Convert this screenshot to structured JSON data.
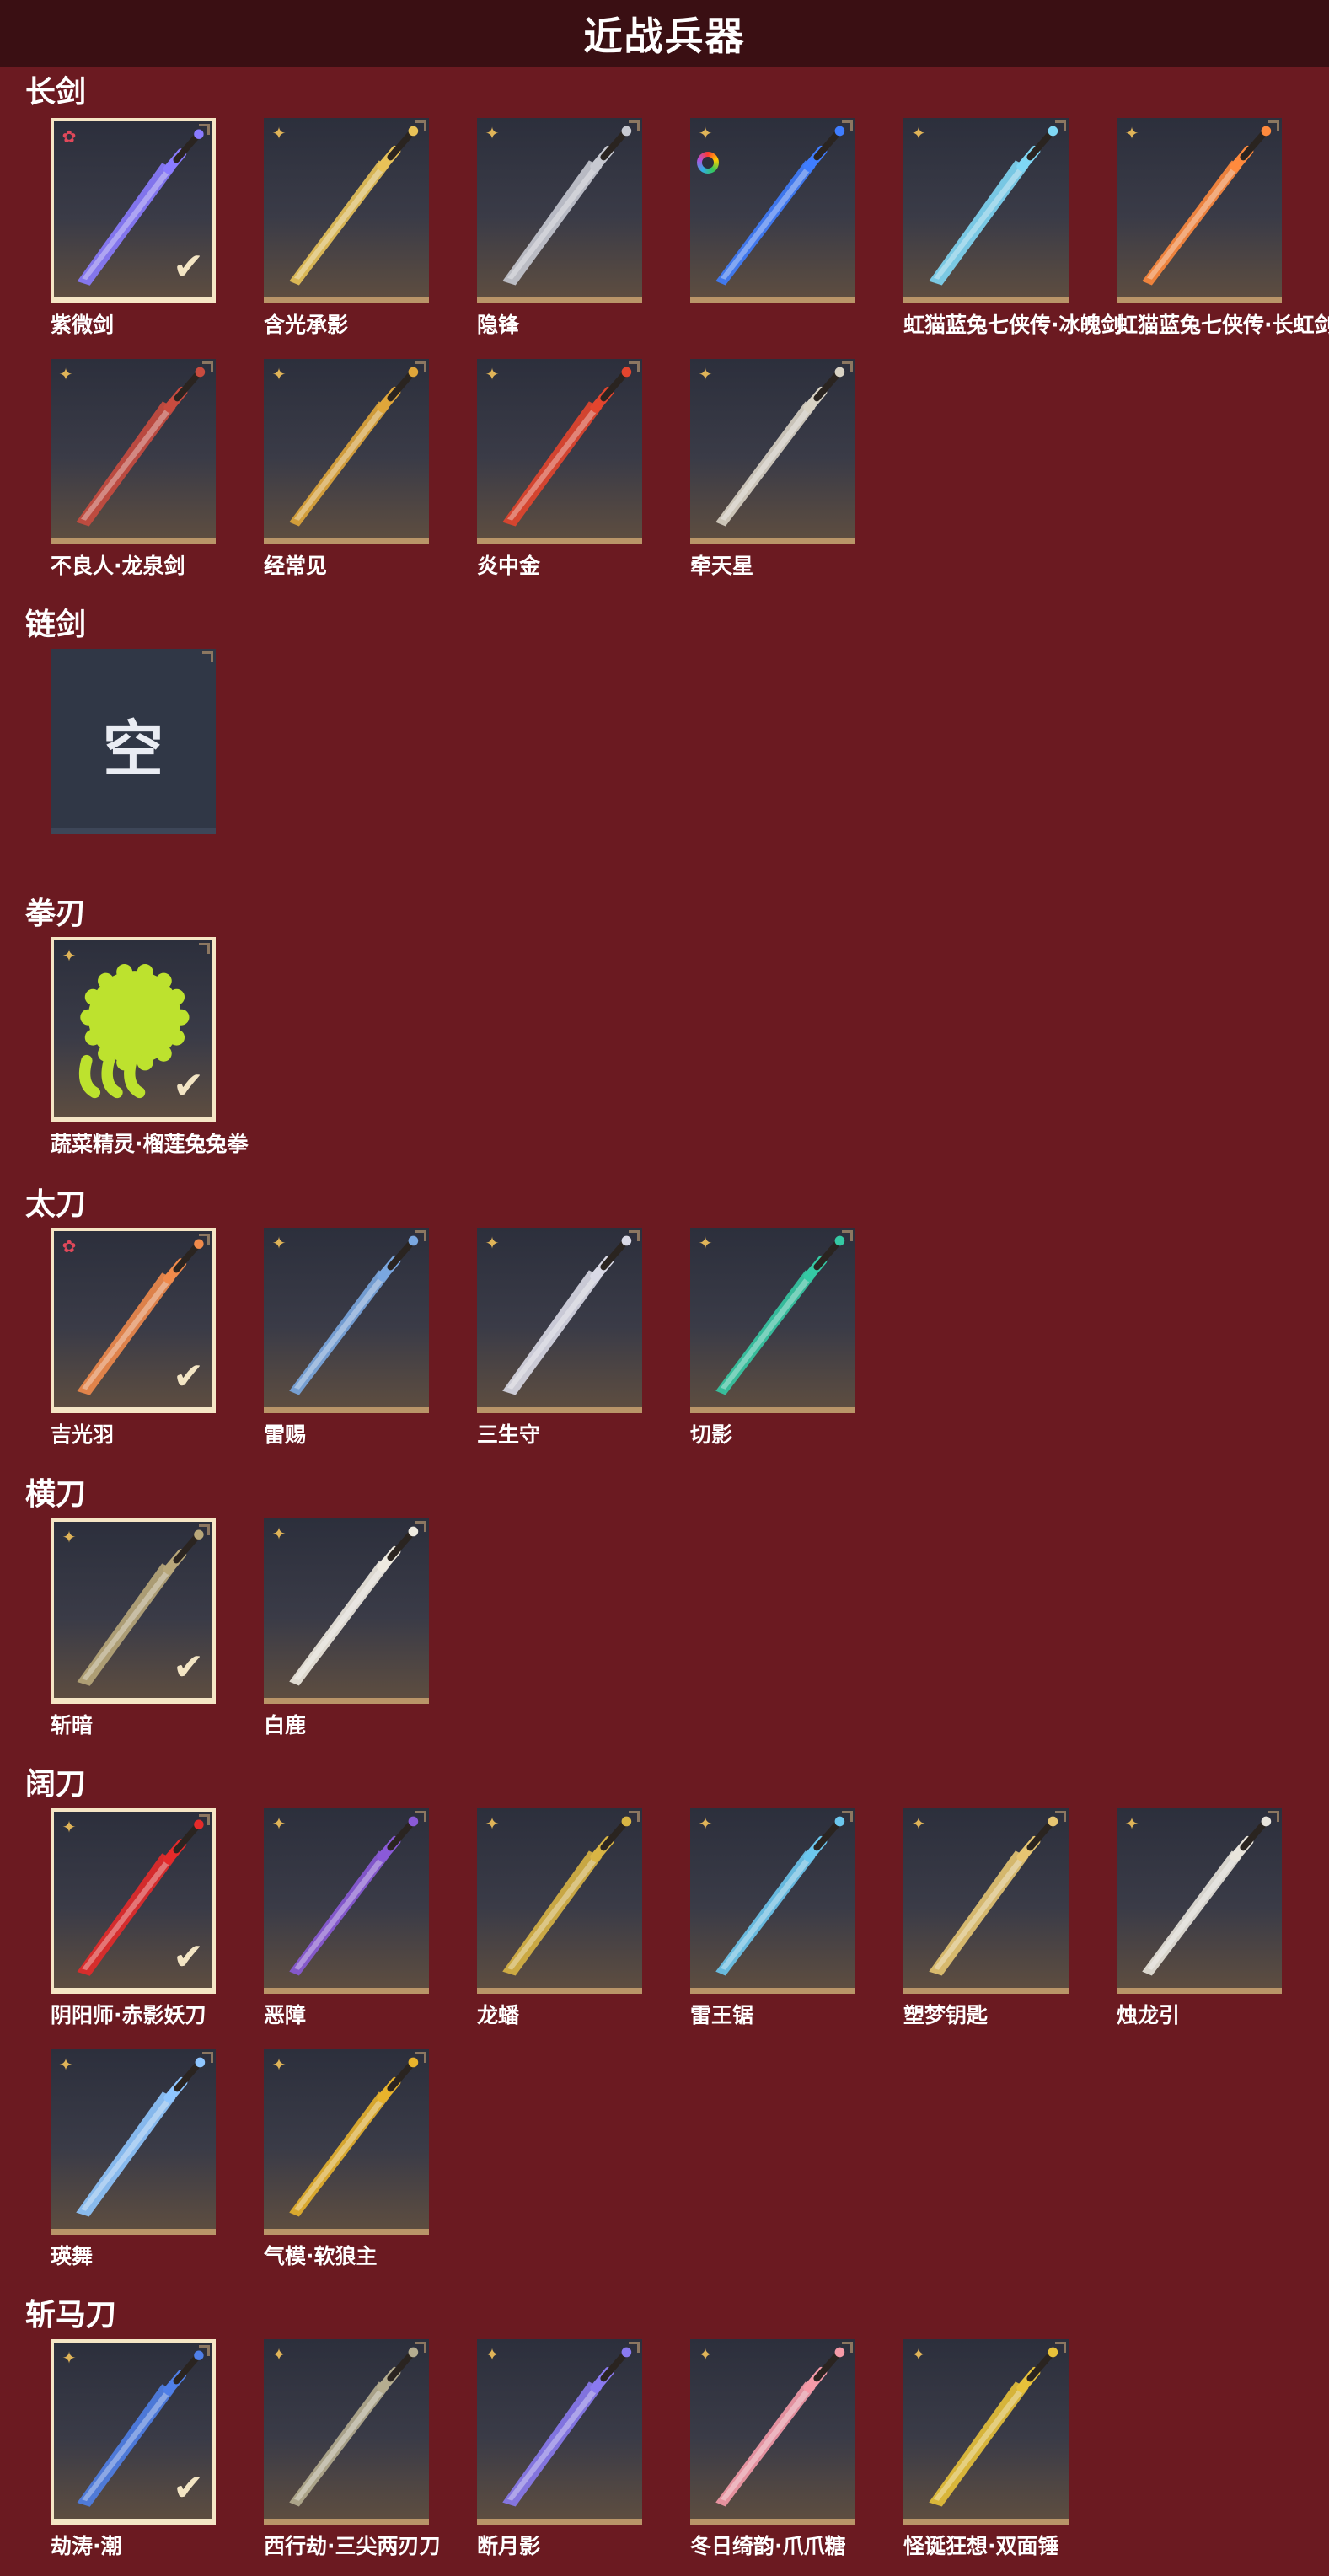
{
  "header": {
    "title": "近战兵器"
  },
  "categories": [
    {
      "title": "长剑",
      "items": [
        {
          "name": "紫微剑",
          "badge": "star",
          "selected": true,
          "rainbow": false,
          "color": "#8a7bff"
        },
        {
          "name": "含光承影",
          "badge": "shuriken",
          "selected": false,
          "rainbow": false,
          "color": "#e8c258"
        },
        {
          "name": "隐锋",
          "badge": "shuriken",
          "selected": false,
          "rainbow": false,
          "color": "#c7c9d1"
        },
        {
          "name": "",
          "badge": "shuriken",
          "selected": false,
          "rainbow": true,
          "color": "#3f7dff"
        },
        {
          "name": "虹猫蓝兔七侠传·冰魄剑",
          "badge": "shuriken",
          "selected": false,
          "rainbow": false,
          "color": "#7fd7f5"
        },
        {
          "name": "虹猫蓝兔七侠传·长虹剑",
          "badge": "shuriken",
          "selected": false,
          "rainbow": false,
          "color": "#ff8a3d"
        },
        {
          "name": "不良人·龙泉剑",
          "badge": "shuriken",
          "selected": false,
          "rainbow": false,
          "color": "#c94b3f"
        },
        {
          "name": "经常见",
          "badge": "shuriken",
          "selected": false,
          "rainbow": false,
          "color": "#e0a63a"
        },
        {
          "name": "炎中金",
          "badge": "shuriken",
          "selected": false,
          "rainbow": false,
          "color": "#e3452e"
        },
        {
          "name": "牵天星",
          "badge": "shuriken",
          "selected": false,
          "rainbow": false,
          "color": "#d8d2c4"
        }
      ]
    },
    {
      "title": "链剑",
      "items": [
        {
          "name": "",
          "empty": true,
          "empty_label": "空"
        }
      ]
    },
    {
      "title": "拳刃",
      "items": [
        {
          "name": "蔬菜精灵·榴莲兔兔拳",
          "badge": "shuriken",
          "selected": true,
          "rainbow": false,
          "color": "#bde22e"
        }
      ]
    },
    {
      "title": "太刀",
      "items": [
        {
          "name": "吉光羽",
          "badge": "star",
          "selected": true,
          "rainbow": false,
          "color": "#f08a4b"
        },
        {
          "name": "雷赐",
          "badge": "shuriken",
          "selected": false,
          "rainbow": false,
          "color": "#7aa7e0"
        },
        {
          "name": "三生守",
          "badge": "shuriken",
          "selected": false,
          "rainbow": false,
          "color": "#d9d9e6"
        },
        {
          "name": "切影",
          "badge": "shuriken",
          "selected": false,
          "rainbow": false,
          "color": "#35c9a4"
        }
      ]
    },
    {
      "title": "横刀",
      "items": [
        {
          "name": "斩暗",
          "badge": "shuriken",
          "selected": true,
          "rainbow": false,
          "color": "#b8a77a"
        },
        {
          "name": "白鹿",
          "badge": "shuriken",
          "selected": false,
          "rainbow": false,
          "color": "#eeeae0"
        }
      ]
    },
    {
      "title": "阔刀",
      "items": [
        {
          "name": "阴阳师·赤影妖刀",
          "badge": "shuriken",
          "selected": true,
          "rainbow": false,
          "color": "#e52a2a"
        },
        {
          "name": "恶障",
          "badge": "shuriken",
          "selected": false,
          "rainbow": false,
          "color": "#8a5ad8"
        },
        {
          "name": "龙蟠",
          "badge": "shuriken",
          "selected": false,
          "rainbow": false,
          "color": "#d8b444"
        },
        {
          "name": "雷王锯",
          "badge": "shuriken",
          "selected": false,
          "rainbow": false,
          "color": "#6cc7ee"
        },
        {
          "name": "塑梦钥匙",
          "badge": "shuriken",
          "selected": false,
          "rainbow": false,
          "color": "#e6c572"
        },
        {
          "name": "烛龙引",
          "badge": "shuriken",
          "selected": false,
          "rainbow": false,
          "color": "#e8e4dc"
        },
        {
          "name": "瑛舞",
          "badge": "shuriken",
          "selected": false,
          "rainbow": false,
          "color": "#8fc6ff"
        },
        {
          "name": "气模·软狼主",
          "badge": "shuriken",
          "selected": false,
          "rainbow": false,
          "color": "#e8b32c"
        }
      ]
    },
    {
      "title": "斩马刀",
      "items": [
        {
          "name": "劫涛·潮",
          "badge": "shuriken",
          "selected": true,
          "rainbow": false,
          "color": "#4f7fe8"
        },
        {
          "name": "西行劫·三尖两刃刀",
          "badge": "shuriken",
          "selected": false,
          "rainbow": false,
          "color": "#b5ad90"
        },
        {
          "name": "断月影",
          "badge": "shuriken",
          "selected": false,
          "rainbow": false,
          "color": "#8a7af0"
        },
        {
          "name": "冬日绮韵·爪爪糖",
          "badge": "shuriken",
          "selected": false,
          "rainbow": false,
          "color": "#f59aa8"
        },
        {
          "name": "怪诞狂想·双面锤",
          "badge": "shuriken",
          "selected": false,
          "rainbow": false,
          "color": "#e8c23a"
        }
      ]
    }
  ]
}
